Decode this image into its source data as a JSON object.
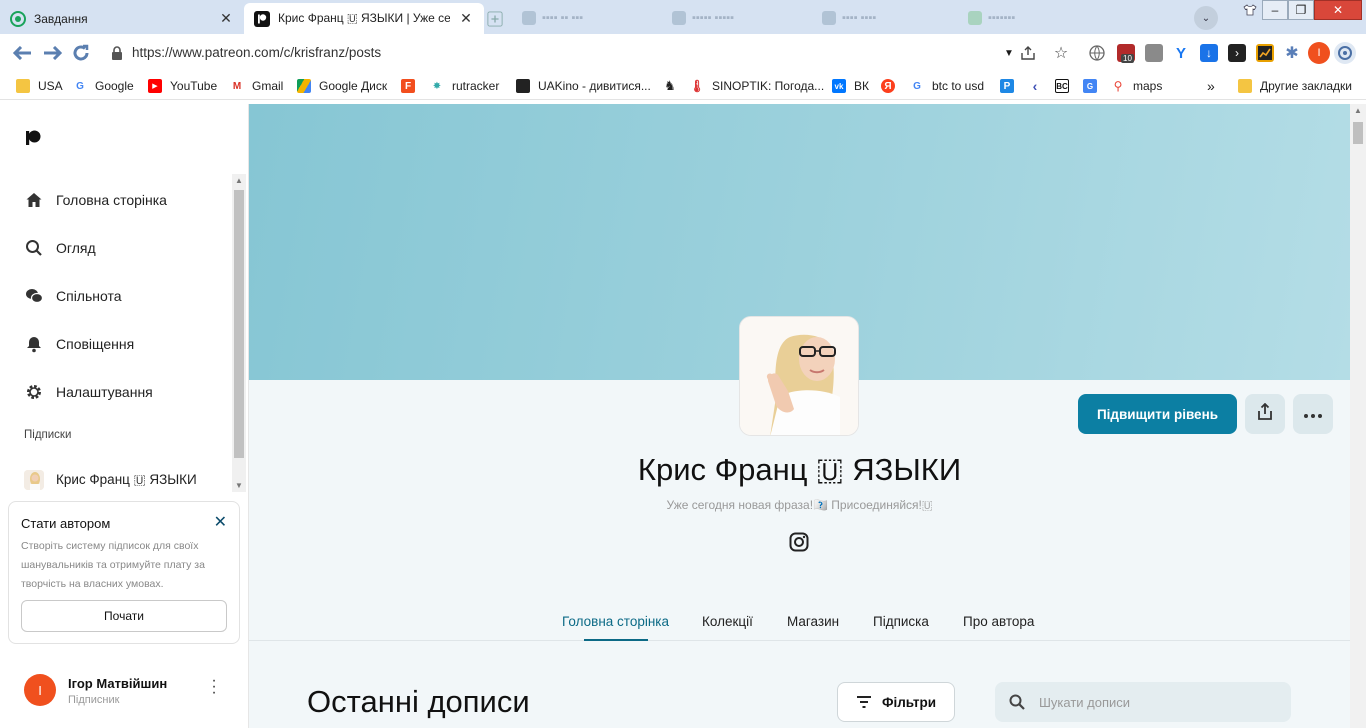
{
  "browser": {
    "tabs": [
      {
        "title": "Завдання",
        "active": false
      },
      {
        "title": "Крис Франц 🇺 ЯЗЫКИ | Уже сегод",
        "active": true
      }
    ],
    "url": "https://www.patreon.com/c/krisfranz/posts",
    "profile_initial": "I",
    "extension_badge": "10",
    "bookmarks": [
      "USA",
      "Google",
      "YouTube",
      "Gmail",
      "Google Диск",
      "rutracker",
      "UAKino - дивитися...",
      "SINOPTIK: Погода...",
      "ВК",
      "btc to usd",
      "maps"
    ],
    "bookmarks_overflow": "»",
    "other_bookmarks": "Другие закладки"
  },
  "colors": {
    "accent": "#0c7fa3",
    "active_tab": "#0c6a86",
    "banner": "#9ed2dd",
    "avatar_user": "#f0501e"
  },
  "sidebar": {
    "items": [
      {
        "label": "Головна сторінка",
        "icon": "home-icon"
      },
      {
        "label": "Огляд",
        "icon": "search-icon"
      },
      {
        "label": "Спільнота",
        "icon": "chat-icon"
      },
      {
        "label": "Сповіщення",
        "icon": "bell-icon"
      },
      {
        "label": "Налаштування",
        "icon": "gear-icon"
      }
    ],
    "section_label": "Підписки",
    "subscription": "Крис Франц 🇺 ЯЗЫКИ",
    "creator_card": {
      "title": "Стати автором",
      "description": "Створіть систему підписок для своїх шанувальників та отримуйте плату за творчість на власних умовах.",
      "button": "Почати"
    },
    "user": {
      "initial": "I",
      "name": "Ігор Матвійшин",
      "role": "Підписник"
    }
  },
  "main": {
    "upgrade_button": "Підвищити рівень",
    "creator_name": "Крис Франц 🇺 ЯЗЫКИ",
    "tagline": "Уже сегодня новая фраза!🇺🇺 Присоединяйся!🇺",
    "tabs": [
      "Головна сторінка",
      "Колекції",
      "Магазин",
      "Підписка",
      "Про автора"
    ],
    "active_tab": "Головна сторінка",
    "posts_title": "Останні дописи",
    "filter_button": "Фільтри",
    "search_placeholder": "Шукати дописи"
  }
}
